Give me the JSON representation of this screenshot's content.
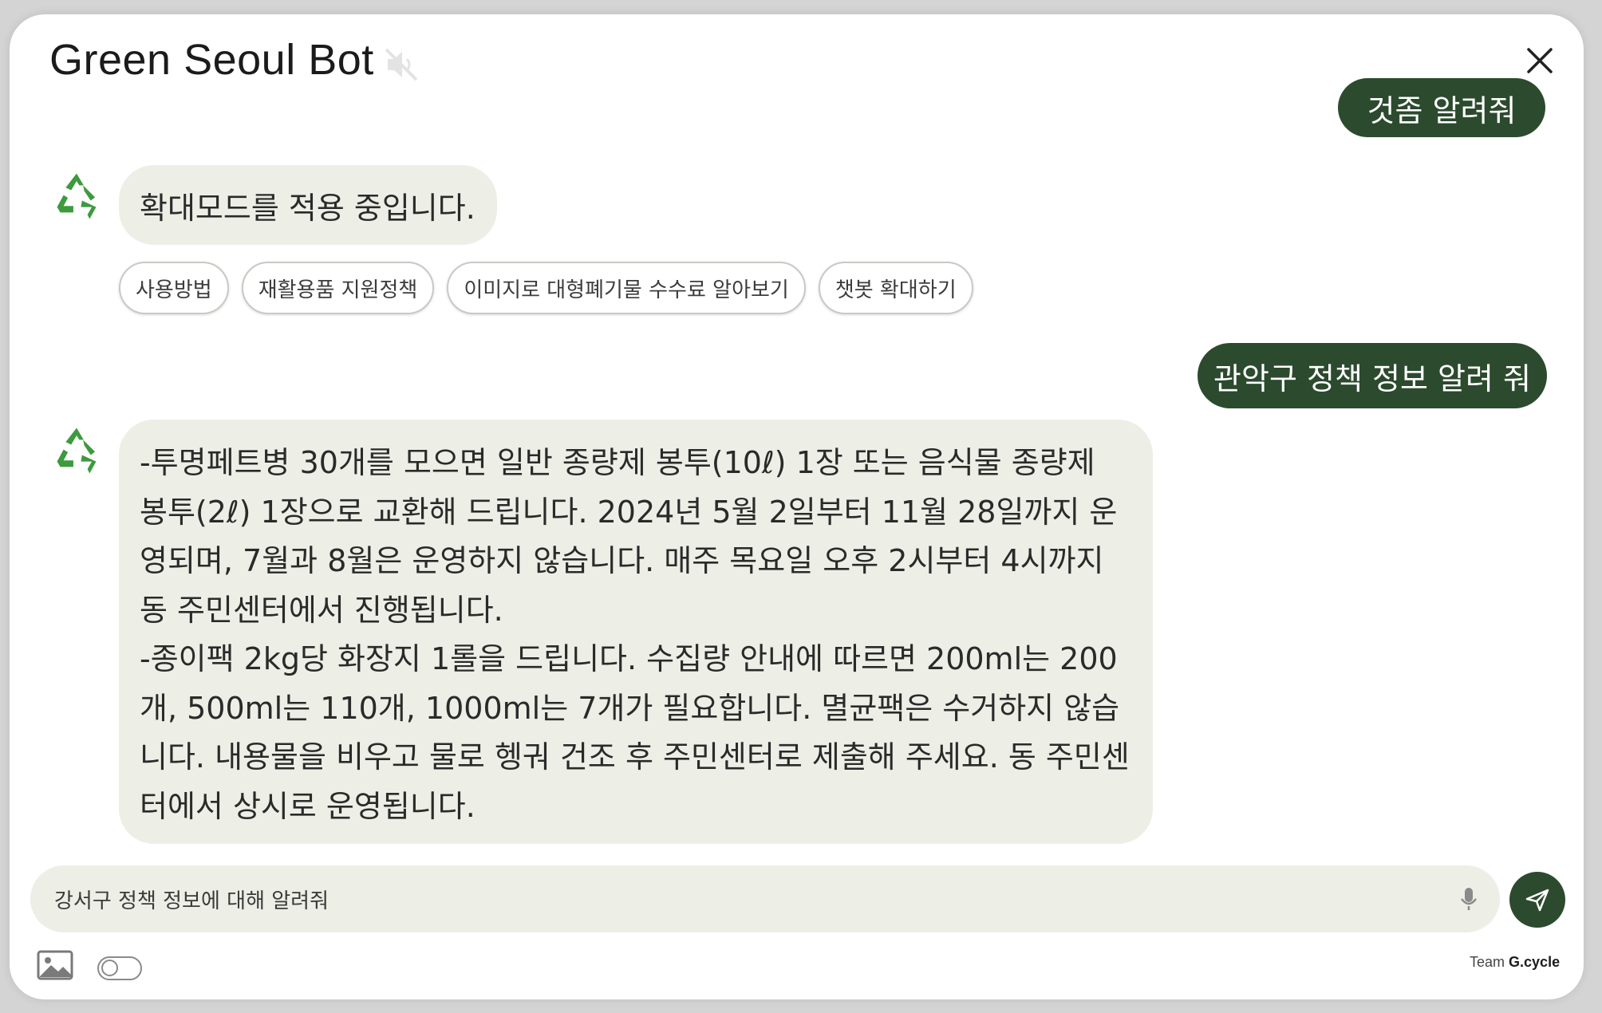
{
  "app": {
    "title": "Green Seoul Bot",
    "close_icon": "close-icon",
    "mute_icon": "speaker-muted-icon"
  },
  "colors": {
    "accent_dark_green": "#2c4a2e",
    "bot_bubble_bg": "#edeee6",
    "recycle_green": "#3d9a3d"
  },
  "messages": {
    "user_partial": "것좀 알려줘",
    "bot_1": "확대모드를 적용 중입니다.",
    "chips": [
      "사용방법",
      "재활용품 지원정책",
      "이미지로 대형폐기물 수수료 알아보기",
      "챗봇 확대하기"
    ],
    "user_2": "관악구 정책 정보 알려 줘",
    "bot_2": {
      "paragraph_1": "-투명페트병 30개를 모으면 일반 종량제 봉투(10ℓ) 1장 또는 음식물 종량제 봉투(2ℓ) 1장으로 교환해 드립니다. 2024년 5월 2일부터 11월 28일까지 운영되며, 7월과 8월은 운영하지 않습니다. 매주 목요일 오후 2시부터 4시까지 동 주민센터에서 진행됩니다.",
      "paragraph_2": "-종이팩 2kg당 화장지 1롤을 드립니다. 수집량 안내에 따르면 200ml는 200개, 500ml는 110개, 1000ml는 7개가 필요합니다. 멸균팩은 수거하지 않습니다. 내용물을 비우고 물로 헹궈 건조 후 주민센터로 제출해 주세요. 동 주민센터에서 상시로 운영됩니다."
    }
  },
  "input": {
    "value": "강서구 정책 정보에 대해 알려줘",
    "mic_icon": "microphone-icon",
    "send_icon": "send-icon"
  },
  "footer": {
    "image_icon": "image-icon",
    "toggle_state": "off",
    "team_prefix": "Team",
    "team_name": "G.cycle"
  }
}
